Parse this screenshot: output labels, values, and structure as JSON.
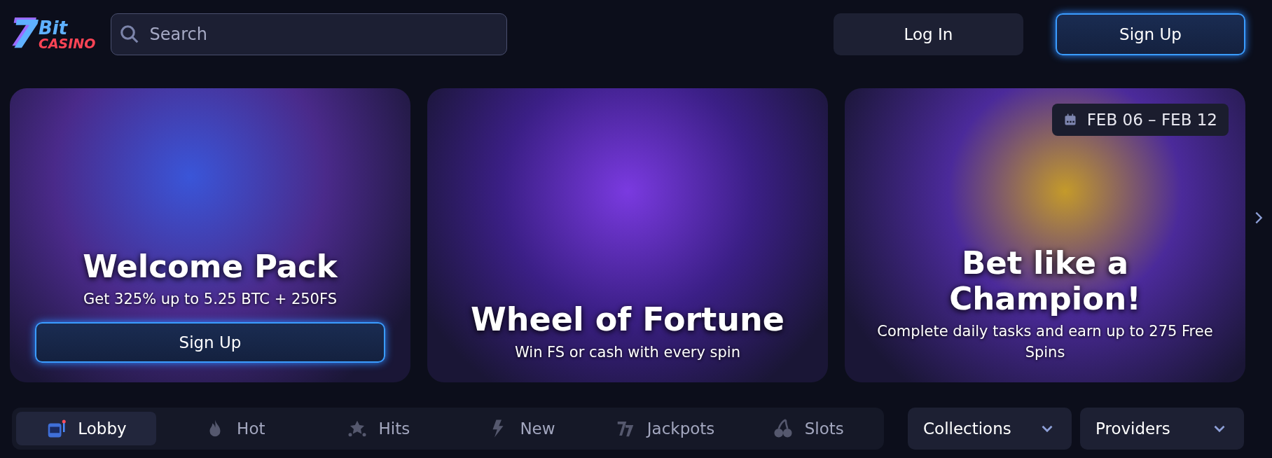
{
  "logo": {
    "number": "7",
    "word": "Bit",
    "sub": "CASINO"
  },
  "search": {
    "placeholder": "Search"
  },
  "auth_buttons": [
    {
      "label": "Log In",
      "kind": "secondary"
    },
    {
      "label": "Sign Up",
      "kind": "primary"
    }
  ],
  "banners": [
    {
      "kind": "slots",
      "title": "Welcome Pack",
      "subtitle": "Get 325% up to 5.25 BTC + 250FS",
      "button": "Sign Up"
    },
    {
      "kind": "wheel",
      "title": "Wheel of Fortune",
      "subtitle": "Win FS or cash with every spin"
    },
    {
      "kind": "medal",
      "date": "FEB 06 – FEB 12",
      "title": "Bet like a Champion!",
      "subtitle": "Complete daily tasks and earn up to 275 Free Spins"
    }
  ],
  "categories": [
    {
      "label": "Lobby",
      "kind": "slot",
      "selected": true
    },
    {
      "label": "Hot",
      "kind": "flame",
      "selected": false
    },
    {
      "label": "Hits",
      "kind": "stars",
      "selected": false
    },
    {
      "label": "New",
      "kind": "bolt",
      "selected": false
    },
    {
      "label": "Jackpots",
      "kind": "sevens",
      "selected": false
    },
    {
      "label": "Slots",
      "kind": "cherry",
      "selected": false
    }
  ],
  "dropdowns": [
    {
      "label": "Collections"
    },
    {
      "label": "Providers"
    }
  ]
}
